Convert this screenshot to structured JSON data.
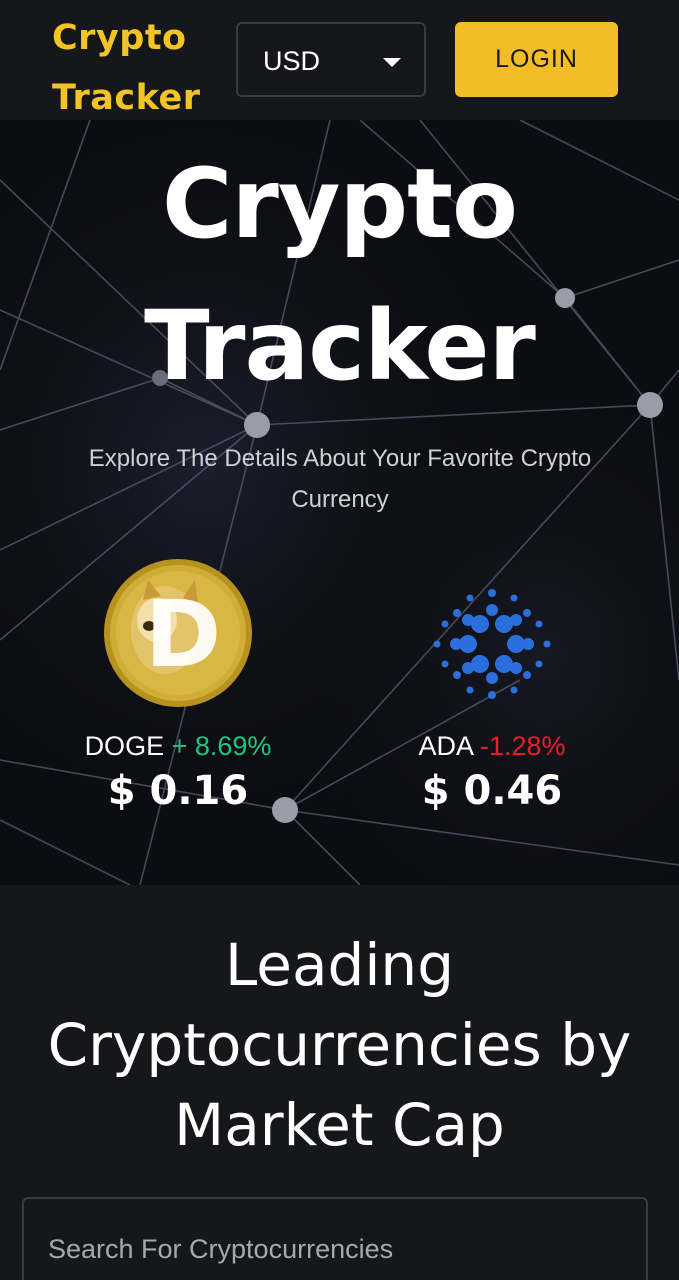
{
  "header": {
    "brand": "Crypto Tracker",
    "currency": "USD",
    "login_label": "LOGIN"
  },
  "hero": {
    "title_line1": "Crypto",
    "title_line2": "Tracker",
    "subtitle": "Explore The Details About Your Favorite Crypto Currency"
  },
  "coins": [
    {
      "symbol": "DOGE",
      "change": "+ 8.69%",
      "price": "$ 0.16",
      "trend": "up",
      "logo": "dogecoin-logo"
    },
    {
      "symbol": "ADA",
      "change": "-1.28%",
      "price": "$ 0.46",
      "trend": "down",
      "logo": "cardano-logo"
    }
  ],
  "leading": {
    "title": "Leading Cryptocurrencies by Market Cap",
    "search_placeholder": "Search For Cryptocurrencies"
  },
  "colors": {
    "accent": "#f2bd27",
    "brand_text": "#f2c428",
    "positive": "#1fc57e",
    "negative": "#e5202a",
    "background": "#16171a",
    "cardano_blue": "#2a6fdb",
    "doge_gold": "#c9a227"
  }
}
